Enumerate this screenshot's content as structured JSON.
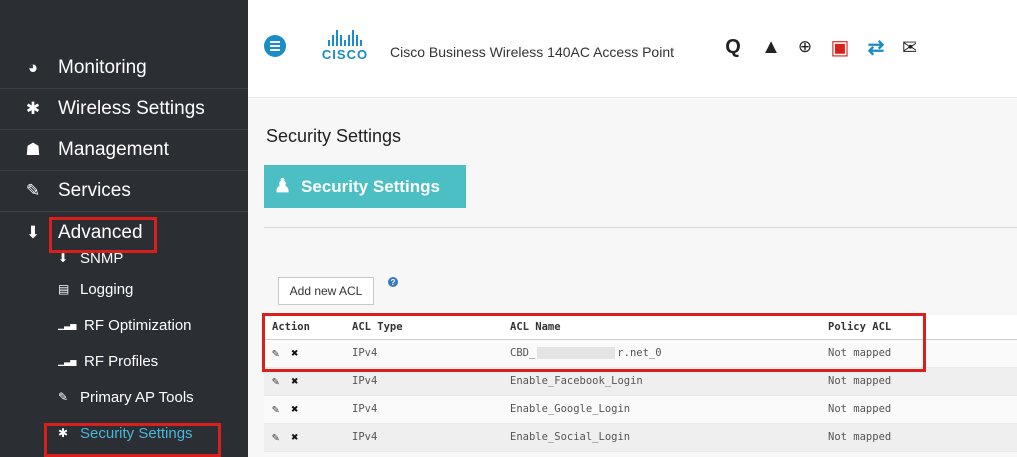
{
  "sidebar": {
    "items": [
      {
        "label": "Monitoring",
        "icon": "dashboard-icon",
        "glyph": "◕"
      },
      {
        "label": "Wireless Settings",
        "icon": "gear-icon",
        "glyph": "✱"
      },
      {
        "label": "Management",
        "icon": "sitemap-icon",
        "glyph": "☗"
      },
      {
        "label": "Services",
        "icon": "wrench-icon",
        "glyph": "✎"
      },
      {
        "label": "Advanced",
        "icon": "download-tray-icon",
        "glyph": "⬇"
      }
    ],
    "subitems": [
      {
        "label": "SNMP",
        "icon": "arrow-down-icon",
        "glyph": "⬇"
      },
      {
        "label": "Logging",
        "icon": "log-file-icon",
        "glyph": "▤"
      },
      {
        "label": "RF Optimization",
        "icon": "signal-bars-icon",
        "glyph": "▁▃▅"
      },
      {
        "label": "RF Profiles",
        "icon": "signal-bars-icon",
        "glyph": "▁▃▅"
      },
      {
        "label": "Primary AP Tools",
        "icon": "wrench-icon",
        "glyph": "✎"
      },
      {
        "label": "Security Settings",
        "icon": "gear-icon",
        "glyph": "✱"
      }
    ]
  },
  "header": {
    "brand": "CISCO",
    "product": "Cisco Business Wireless 140AC Access Point",
    "tools": [
      {
        "name": "search-icon",
        "glyph": "Q"
      },
      {
        "name": "warning-icon",
        "glyph": "▲"
      },
      {
        "name": "download-circle-icon",
        "glyph": "⊕"
      },
      {
        "name": "save-icon",
        "glyph": "▣"
      },
      {
        "name": "transfer-icon",
        "glyph": "⇄"
      },
      {
        "name": "mail-icon",
        "glyph": "✉"
      }
    ]
  },
  "main": {
    "page_title": "Security Settings",
    "banner_label": "Security Settings",
    "add_acl_label": "Add new ACL",
    "table": {
      "headers": [
        "Action",
        "ACL Type",
        "ACL Name",
        "Policy ACL"
      ],
      "rows": [
        {
          "type": "IPv4",
          "name_prefix": "CBD_",
          "name_suffix": "r.net_0",
          "policy": "Not mapped"
        },
        {
          "type": "IPv4",
          "name": "Enable_Facebook_Login",
          "policy": "Not mapped"
        },
        {
          "type": "IPv4",
          "name": "Enable_Google_Login",
          "policy": "Not mapped"
        },
        {
          "type": "IPv4",
          "name": "Enable_Social_Login",
          "policy": "Not mapped"
        }
      ]
    }
  },
  "colors": {
    "sidebar_bg": "#2b2e33",
    "accent_teal": "#4cbfc4",
    "cisco_blue": "#1a8cc8",
    "highlight_red": "#d9201d",
    "save_red": "#d9201d",
    "active_link": "#4ab6d8"
  }
}
